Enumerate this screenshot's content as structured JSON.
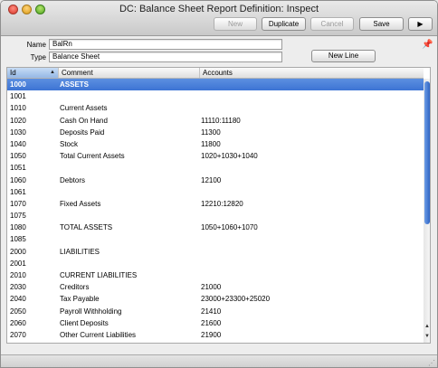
{
  "window": {
    "title": "DC: Balance Sheet Report Definition: Inspect"
  },
  "toolbar": {
    "new_label": "New",
    "duplicate_label": "Duplicate",
    "cancel_label": "Cancel",
    "save_label": "Save",
    "forward_label": "▶"
  },
  "form": {
    "name_label": "Name",
    "name_value": "BalRn",
    "type_label": "Type",
    "type_value": "Balance Sheet",
    "new_line_label": "New Line",
    "pin_icon": "pin-icon"
  },
  "table": {
    "headers": {
      "id": "Id",
      "comment": "Comment",
      "accounts": "Accounts"
    },
    "rows": [
      {
        "id": "1000",
        "comment": "ASSETS",
        "accounts": ""
      },
      {
        "id": "1001",
        "comment": "",
        "accounts": ""
      },
      {
        "id": "1010",
        "comment": "Current Assets",
        "accounts": ""
      },
      {
        "id": "1020",
        "comment": "Cash On Hand",
        "accounts": "11110:11180"
      },
      {
        "id": "1030",
        "comment": "Deposits Paid",
        "accounts": "11300"
      },
      {
        "id": "1040",
        "comment": "Stock",
        "accounts": "11800"
      },
      {
        "id": "1050",
        "comment": "Total Current Assets",
        "accounts": "1020+1030+1040"
      },
      {
        "id": "1051",
        "comment": "",
        "accounts": ""
      },
      {
        "id": "1060",
        "comment": "Debtors",
        "accounts": "12100"
      },
      {
        "id": "1061",
        "comment": "",
        "accounts": ""
      },
      {
        "id": "1070",
        "comment": "Fixed Assets",
        "accounts": "12210:12820"
      },
      {
        "id": "1075",
        "comment": "",
        "accounts": ""
      },
      {
        "id": "1080",
        "comment": "TOTAL ASSETS",
        "accounts": "1050+1060+1070"
      },
      {
        "id": "1085",
        "comment": "",
        "accounts": ""
      },
      {
        "id": "2000",
        "comment": "LIABILITIES",
        "accounts": ""
      },
      {
        "id": "2001",
        "comment": "",
        "accounts": ""
      },
      {
        "id": "2010",
        "comment": "CURRENT LIABILITIES",
        "accounts": ""
      },
      {
        "id": "2030",
        "comment": "Creditors",
        "accounts": "21000"
      },
      {
        "id": "2040",
        "comment": "Tax Payable",
        "accounts": "23000+23300+25020"
      },
      {
        "id": "2050",
        "comment": "Payroll Withholding",
        "accounts": "21410"
      },
      {
        "id": "2060",
        "comment": "Client Deposits",
        "accounts": "21600"
      },
      {
        "id": "2070",
        "comment": "Other Current Liabilities",
        "accounts": "21900"
      }
    ]
  }
}
